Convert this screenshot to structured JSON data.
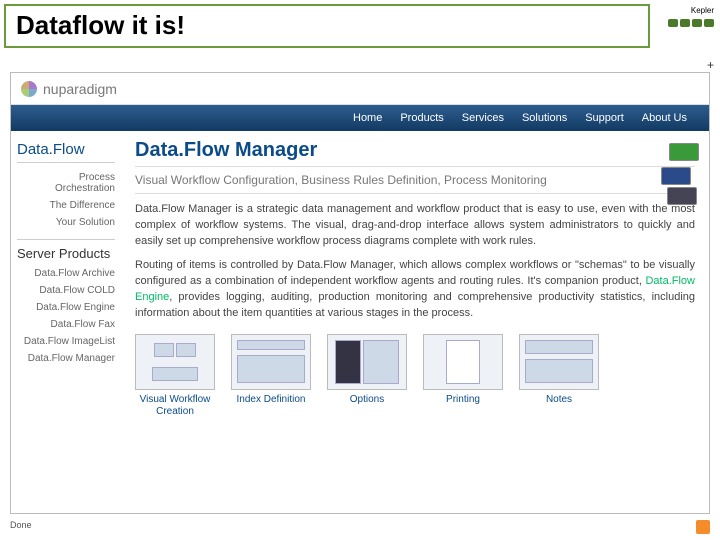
{
  "slide": {
    "title": "Dataflow it is!",
    "kepler": "Kepler"
  },
  "logo": "nuparadigm",
  "nav": [
    "Home",
    "Products",
    "Services",
    "Solutions",
    "Support",
    "About Us"
  ],
  "sidebar": {
    "brand": "Data.Flow",
    "items": [
      "Process Orchestration",
      "The Difference",
      "Your Solution"
    ],
    "section": "Server Products",
    "products": [
      "Data.Flow Archive",
      "Data.Flow COLD",
      "Data.Flow Engine",
      "Data.Flow Fax",
      "Data.Flow ImageList",
      "Data.Flow Manager"
    ]
  },
  "content": {
    "title": "Data.Flow Manager",
    "tagline": "Visual Workflow Configuration, Business Rules Definition, Process Monitoring",
    "p1": "Data.Flow Manager is a strategic data management and workflow product that is easy to use, even with the most complex of workflow systems. The visual, drag-and-drop interface allows system administrators to quickly and easily set up comprehensive workflow process diagrams complete with work rules.",
    "p2a": "Routing of items is controlled by Data.Flow Manager, which allows complex workflows or \"schemas\" to be visually configured as a combination of independent workflow agents and routing rules. It's companion product, ",
    "p2link": "Data.Flow Engine",
    "p2b": ", provides logging, auditing, production monitoring and comprehensive productivity statistics, including information about the item quantities at various stages in the process."
  },
  "thumbs": [
    "Visual Workflow Creation",
    "Index Definition",
    "Options",
    "Printing",
    "Notes"
  ],
  "status": "Done",
  "plus": "+"
}
